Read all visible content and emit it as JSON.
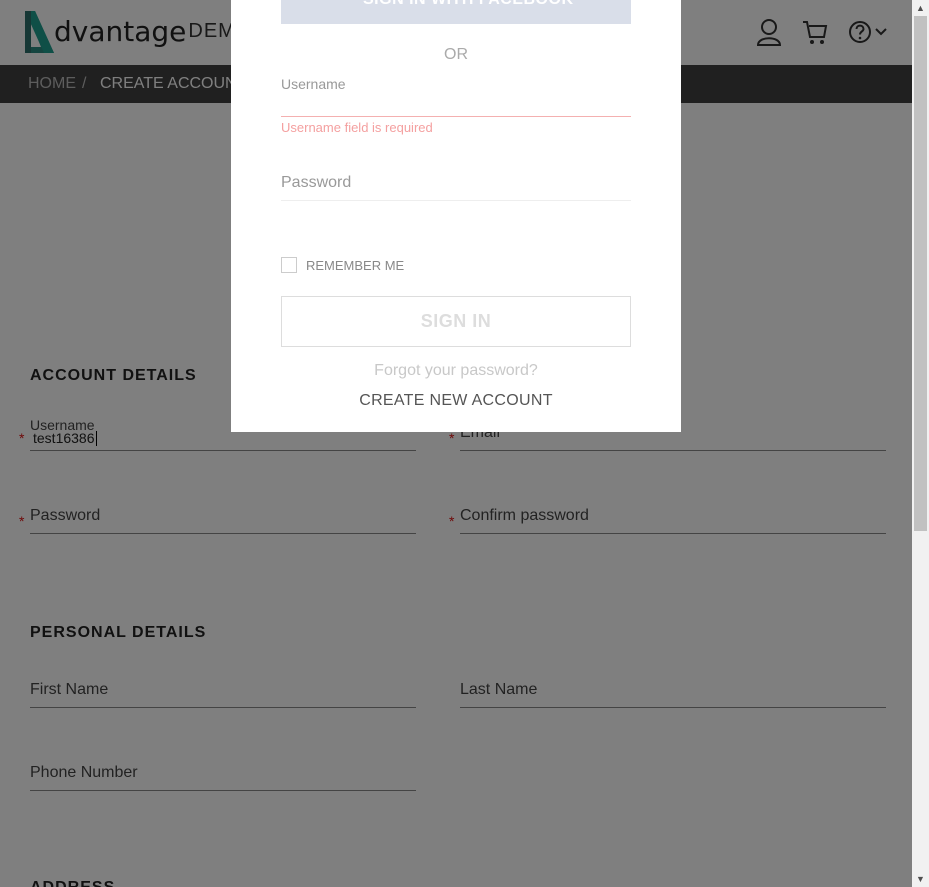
{
  "header": {
    "logo_text": "dvantage",
    "logo_demo": "DEMO",
    "icons": [
      "user-icon",
      "cart-icon",
      "help-icon",
      "chevron-down-icon"
    ]
  },
  "breadcrumb": {
    "home": "HOME",
    "separator": "/",
    "current": "CREATE ACCOUNT"
  },
  "account_details": {
    "title": "ACCOUNT DETAILS",
    "username_label": "Username",
    "username_value": "test16386",
    "email_label": "Email",
    "password_label": "Password",
    "confirm_password_label": "Confirm password",
    "required_mark": "*"
  },
  "personal_details": {
    "title": "PERSONAL DETAILS",
    "first_name_label": "First Name",
    "last_name_label": "Last Name",
    "phone_label": "Phone Number"
  },
  "address": {
    "title": "ADDRESS"
  },
  "login_modal": {
    "facebook_label": "SIGN IN WITH FACEBOOK",
    "or_label": "OR",
    "username_label": "Username",
    "username_error": "Username field is required",
    "password_label": "Password",
    "remember_label": "REMEMBER ME",
    "signin_label": "SIGN IN",
    "forgot_label": "Forgot your password?",
    "create_label": "CREATE NEW ACCOUNT"
  },
  "colors": {
    "brand_teal": "#1e9e8e",
    "breadcrumb_bg": "#414141",
    "error": "#f4a0a0",
    "required": "#dd1111"
  }
}
